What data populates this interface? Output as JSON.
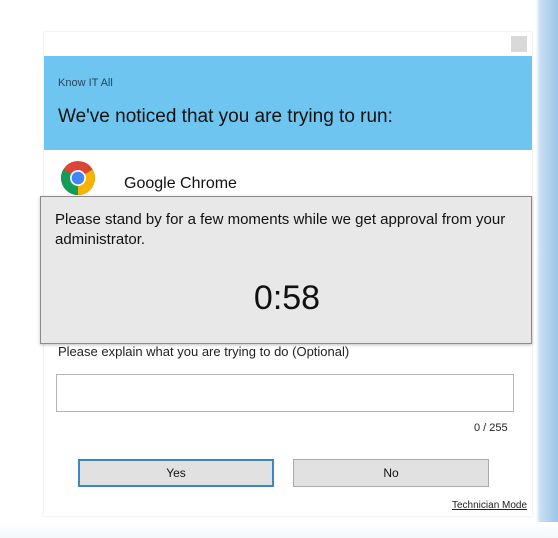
{
  "window": {
    "brand": "Know IT All",
    "headline": "We've noticed that you are trying to run:",
    "close_icon": "close-icon"
  },
  "app": {
    "name": "Google Chrome",
    "icon": "chrome-logo-icon"
  },
  "overlay": {
    "message": "Please stand by for a few moments while we get approval from your administrator.",
    "countdown": "0:58"
  },
  "form": {
    "explain_label": "Please explain what you are trying to do (Optional)",
    "explain_value": "",
    "char_counter": "0 / 255"
  },
  "buttons": {
    "yes_label": "Yes",
    "no_label": "No"
  },
  "footer": {
    "technician_link": "Technician Mode"
  },
  "colors": {
    "banner": "#6ec6f0",
    "overlay": "#e8e8e8",
    "yes_border": "#3d86c6"
  }
}
